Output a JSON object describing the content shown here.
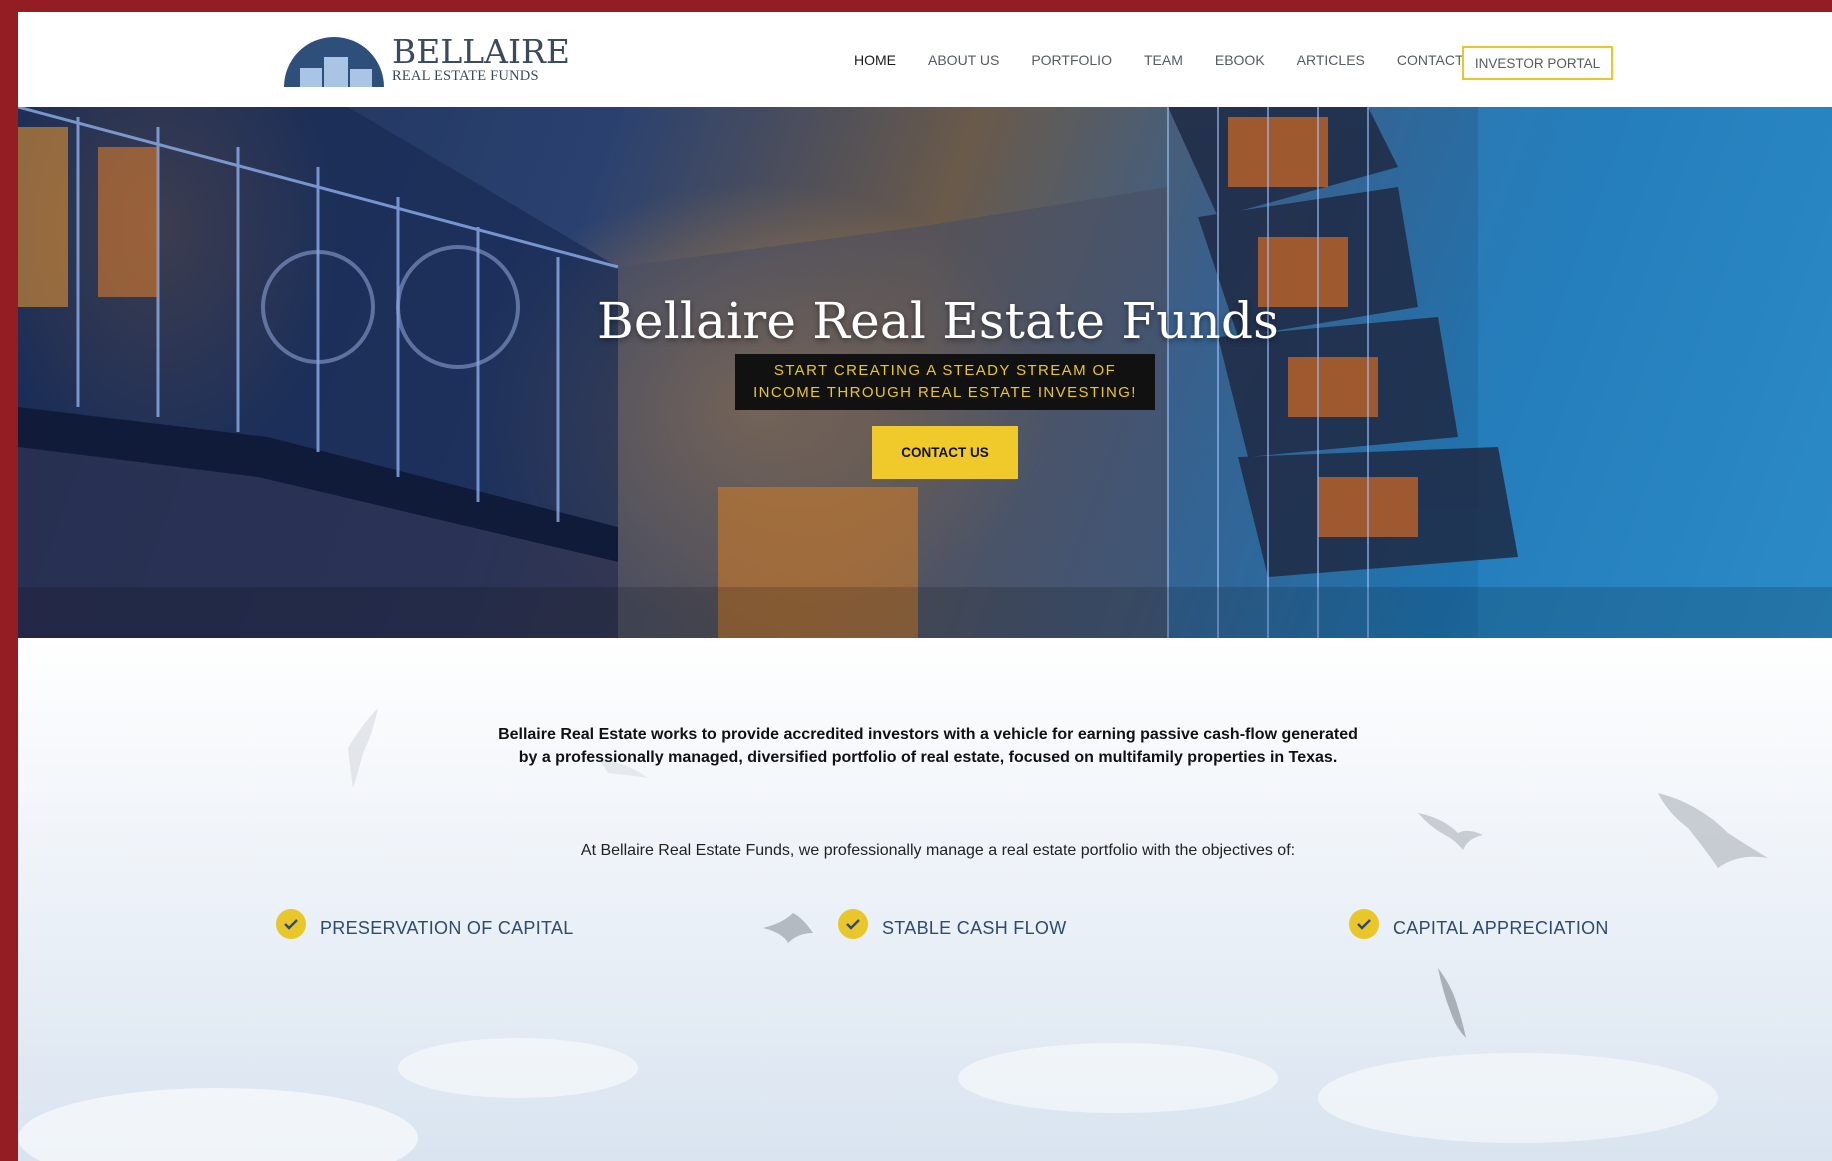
{
  "header": {
    "logo": {
      "main": "BELLAIRE",
      "sub": "REAL ESTATE FUNDS"
    },
    "nav": [
      {
        "label": "HOME",
        "active": true
      },
      {
        "label": "ABOUT US"
      },
      {
        "label": "PORTFOLIO"
      },
      {
        "label": "TEAM"
      },
      {
        "label": "EBOOK"
      },
      {
        "label": "ARTICLES"
      },
      {
        "label": "CONTACT"
      }
    ],
    "portal_button": "INVESTOR PORTAL"
  },
  "hero": {
    "title": "Bellaire Real Estate Funds",
    "subtitle": "START CREATING A STEADY STREAM OF\nINCOME THROUGH REAL ESTATE INVESTING!",
    "cta": "CONTACT US"
  },
  "content": {
    "intro": "Bellaire Real Estate works to provide accredited investors with a vehicle for earning passive cash-flow generated by a professionally managed, diversified portfolio of real estate, focused on multifamily properties in Texas.",
    "objectives_intro": "At Bellaire Real Estate Funds, we professionally manage a real estate portfolio with the objectives of:",
    "objectives": [
      {
        "label": "PRESERVATION OF CAPITAL",
        "icon": "check-icon"
      },
      {
        "label": "STABLE CASH FLOW",
        "icon": "check-icon"
      },
      {
        "label": "CAPITAL APPRECIATION",
        "icon": "check-icon"
      }
    ]
  },
  "colors": {
    "frame": "#931d22",
    "accent_yellow": "#f0c92b",
    "navy": "#2f4a6c",
    "logo_blue": "#2e4f7a",
    "logo_light": "#a9c4e4"
  }
}
